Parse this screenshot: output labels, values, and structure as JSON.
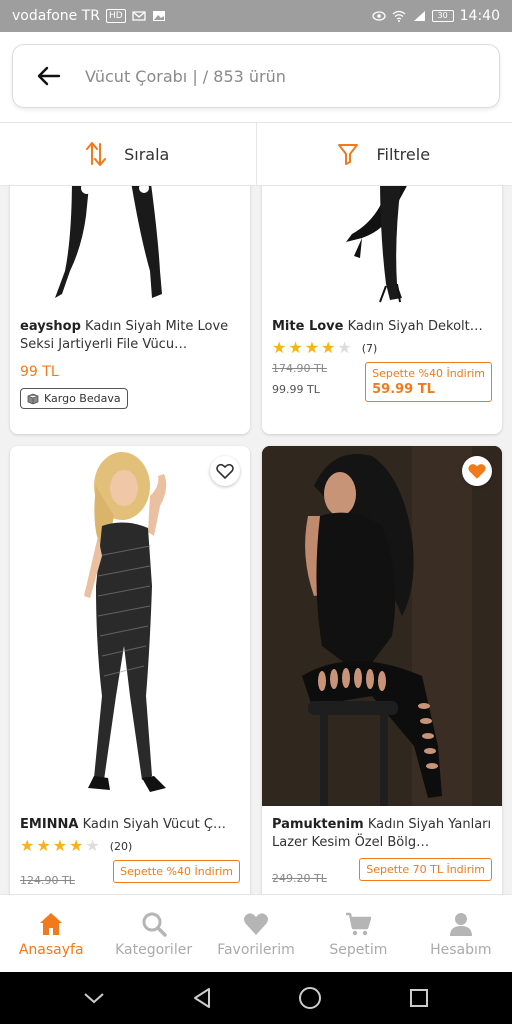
{
  "status_bar": {
    "carrier": "vodafone TR",
    "network_badge": "HD",
    "battery": "30",
    "time": "14:40"
  },
  "search": {
    "text": "Vücut Çorabı | / 853 ürün"
  },
  "toolbar": {
    "sort_label": "Sırala",
    "filter_label": "Filtrele"
  },
  "products": [
    {
      "brand": "eayshop",
      "name": "Kadın Siyah Mite Love Seksi Jartiyerli File Vücu…",
      "price": "99 TL",
      "badge": "Kargo Bedava"
    },
    {
      "brand": "Mite Love",
      "name": "Kadın Siyah Dekolt…",
      "rating": 4,
      "rating_count": "(7)",
      "old_price": "174.90 TL",
      "current_price": "99.99 TL",
      "promo_label": "Sepette %40 İndirim",
      "promo_price": "59.99 TL"
    },
    {
      "brand": "EMINNA",
      "name": "Kadın Siyah Vücut Ç…",
      "rating": 4,
      "rating_count": "(20)",
      "old_price": "124.90 TL",
      "promo_label": "Sepette %40 İndirim",
      "favorited": false
    },
    {
      "brand": "Pamuktenim",
      "name": "Kadın Siyah Yanları Lazer Kesim Özel Bölg…",
      "old_price": "249.20 TL",
      "promo_label": "Sepette 70 TL İndirim",
      "favorited": true
    }
  ],
  "bottom_nav": [
    {
      "label": "Anasayfa",
      "icon": "home-icon",
      "active": true
    },
    {
      "label": "Kategoriler",
      "icon": "search-icon",
      "active": false
    },
    {
      "label": "Favorilerim",
      "icon": "heart-icon",
      "active": false
    },
    {
      "label": "Sepetim",
      "icon": "cart-icon",
      "active": false
    },
    {
      "label": "Hesabım",
      "icon": "user-icon",
      "active": false
    }
  ],
  "colors": {
    "accent": "#f27a1a",
    "star": "#f9b21a",
    "statusbar": "#9e9e9e"
  }
}
